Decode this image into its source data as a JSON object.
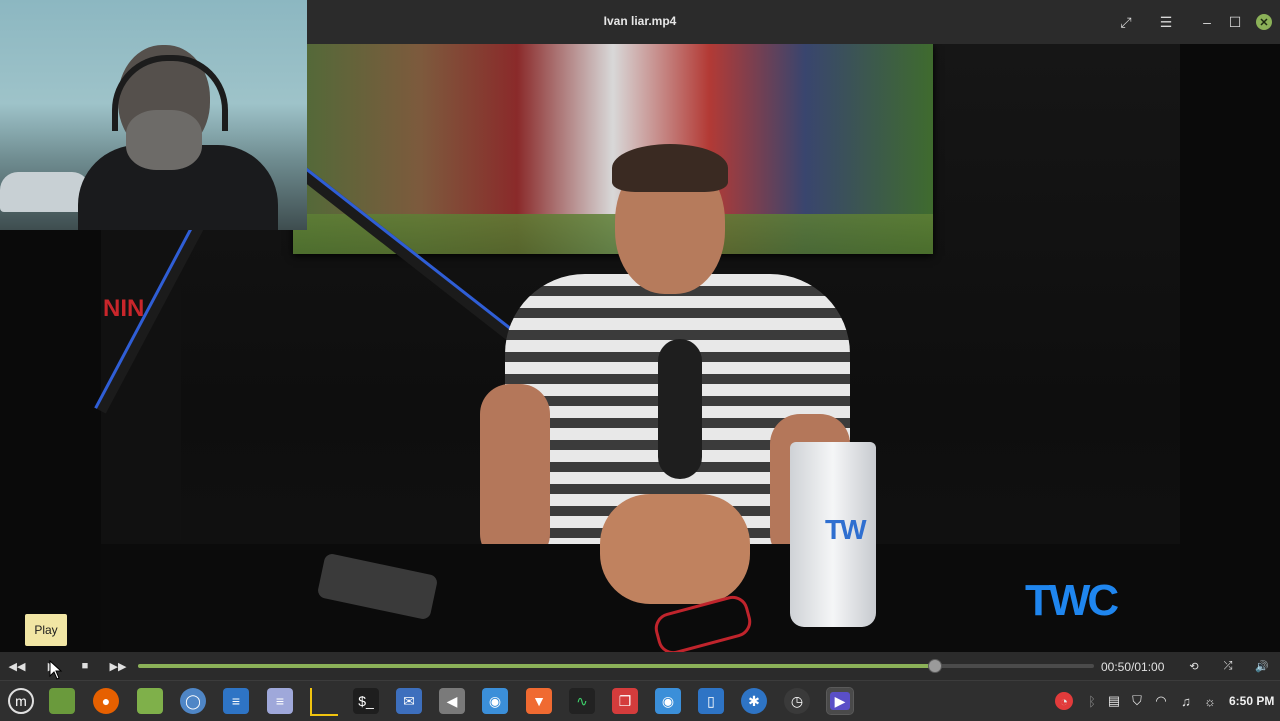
{
  "window": {
    "title": "Ivan liar.mp4"
  },
  "tooltip": {
    "text": "Play"
  },
  "player": {
    "time": "00:50/01:00",
    "progress": 0.833
  },
  "taskbar": {
    "clock": "6:50 PM"
  },
  "video": {
    "logo_text": "TWC",
    "cup_text": "TW",
    "sign_text": "NIN"
  },
  "colors": {
    "accent": "#8bb158",
    "titlebar": "#2b2b2b",
    "taskbar": "#2f2f2f"
  },
  "icons": {
    "titlebar": [
      "fullscreen-icon",
      "menu-icon",
      "minimize-icon",
      "maximize-icon",
      "close-icon"
    ],
    "controls": [
      "rewind-icon",
      "play-icon",
      "stop-icon",
      "fast-forward-icon",
      "repeat-icon",
      "shuffle-icon",
      "volume-icon"
    ],
    "taskbar": [
      "mint-menu-icon",
      "show-desktop-icon",
      "firefox-icon",
      "files-icon",
      "chromium-icon",
      "text-editor-icon",
      "document-icon",
      "system-monitor-icon",
      "terminal-icon",
      "mail-icon",
      "sound-icon",
      "camera-icon",
      "brave-icon",
      "activity-icon",
      "reader-icon",
      "screenshot-icon",
      "phone-icon",
      "accessibility-icon",
      "timeshift-icon",
      "video-player-icon"
    ],
    "tray": [
      "update-icon",
      "bluetooth-icon",
      "clipboard-icon",
      "shield-icon",
      "wifi-icon",
      "music-icon",
      "brightness-icon"
    ]
  }
}
